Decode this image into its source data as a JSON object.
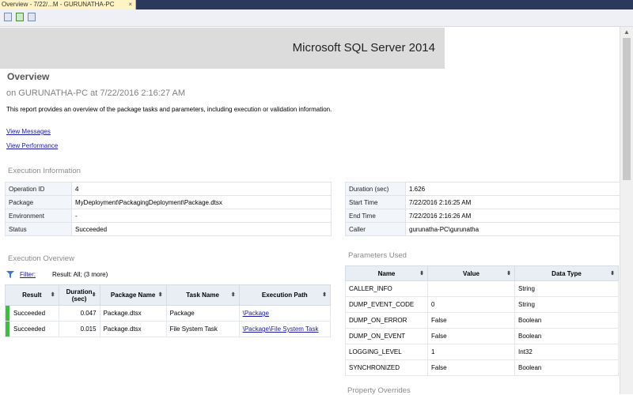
{
  "tab": {
    "title": "Overview - 7/22/...M - GURUNATHA-PC",
    "close": "×"
  },
  "toolbar": {
    "icons": [
      "back-icon",
      "refresh-icon",
      "print-icon"
    ]
  },
  "banner": {
    "product": "Microsoft SQL Server 2014"
  },
  "page": {
    "title": "Overview",
    "subtitle": "on GURUNATHA-PC at 7/22/2016 2:16:27 AM",
    "description": "This report provides an overview of the package tasks and parameters, including execution or validation information.",
    "links": {
      "view_messages": "View Messages",
      "view_performance": "View Performance"
    }
  },
  "execution_info": {
    "heading": "Execution Information",
    "left": [
      {
        "key": "Operation ID",
        "value": "4"
      },
      {
        "key": "Package",
        "value": "MyDeployment\\PackagingDeployment\\Package.dtsx"
      },
      {
        "key": "Environment",
        "value": "-"
      },
      {
        "key": "Status",
        "value": "Succeeded"
      }
    ],
    "right": [
      {
        "key": "Duration (sec)",
        "value": "1.626"
      },
      {
        "key": "Start Time",
        "value": "7/22/2016 2:16:25 AM"
      },
      {
        "key": "End Time",
        "value": "7/22/2016 2:16:26 AM"
      },
      {
        "key": "Caller",
        "value": "gurunatha-PC\\gurunatha"
      }
    ]
  },
  "execution_overview": {
    "heading": "Execution Overview",
    "filter_label": "Filter:",
    "filter_value": "Result: All;  (3 more)",
    "columns": [
      "Result",
      "Duration (sec)",
      "Package Name",
      "Task Name",
      "Execution Path"
    ],
    "rows": [
      {
        "result": "Succeeded",
        "duration": "0.047",
        "package": "Package.dtsx",
        "task": "Package",
        "path": "\\Package"
      },
      {
        "result": "Succeeded",
        "duration": "0.015",
        "package": "Package.dtsx",
        "task": "File System Task",
        "path": "\\Package\\File System Task"
      }
    ],
    "status_color": "#34c534"
  },
  "parameters": {
    "heading": "Parameters Used",
    "columns": [
      "Name",
      "Value",
      "Data Type"
    ],
    "rows": [
      {
        "name": "CALLER_INFO",
        "value": "",
        "type": "String"
      },
      {
        "name": "DUMP_EVENT_CODE",
        "value": "0",
        "type": "String"
      },
      {
        "name": "DUMP_ON_ERROR",
        "value": "False",
        "type": "Boolean"
      },
      {
        "name": "DUMP_ON_EVENT",
        "value": "False",
        "type": "Boolean"
      },
      {
        "name": "LOGGING_LEVEL",
        "value": "1",
        "type": "Int32"
      },
      {
        "name": "SYNCHRONIZED",
        "value": "False",
        "type": "Boolean"
      }
    ]
  },
  "property_overrides": {
    "heading": "Property Overrides"
  }
}
